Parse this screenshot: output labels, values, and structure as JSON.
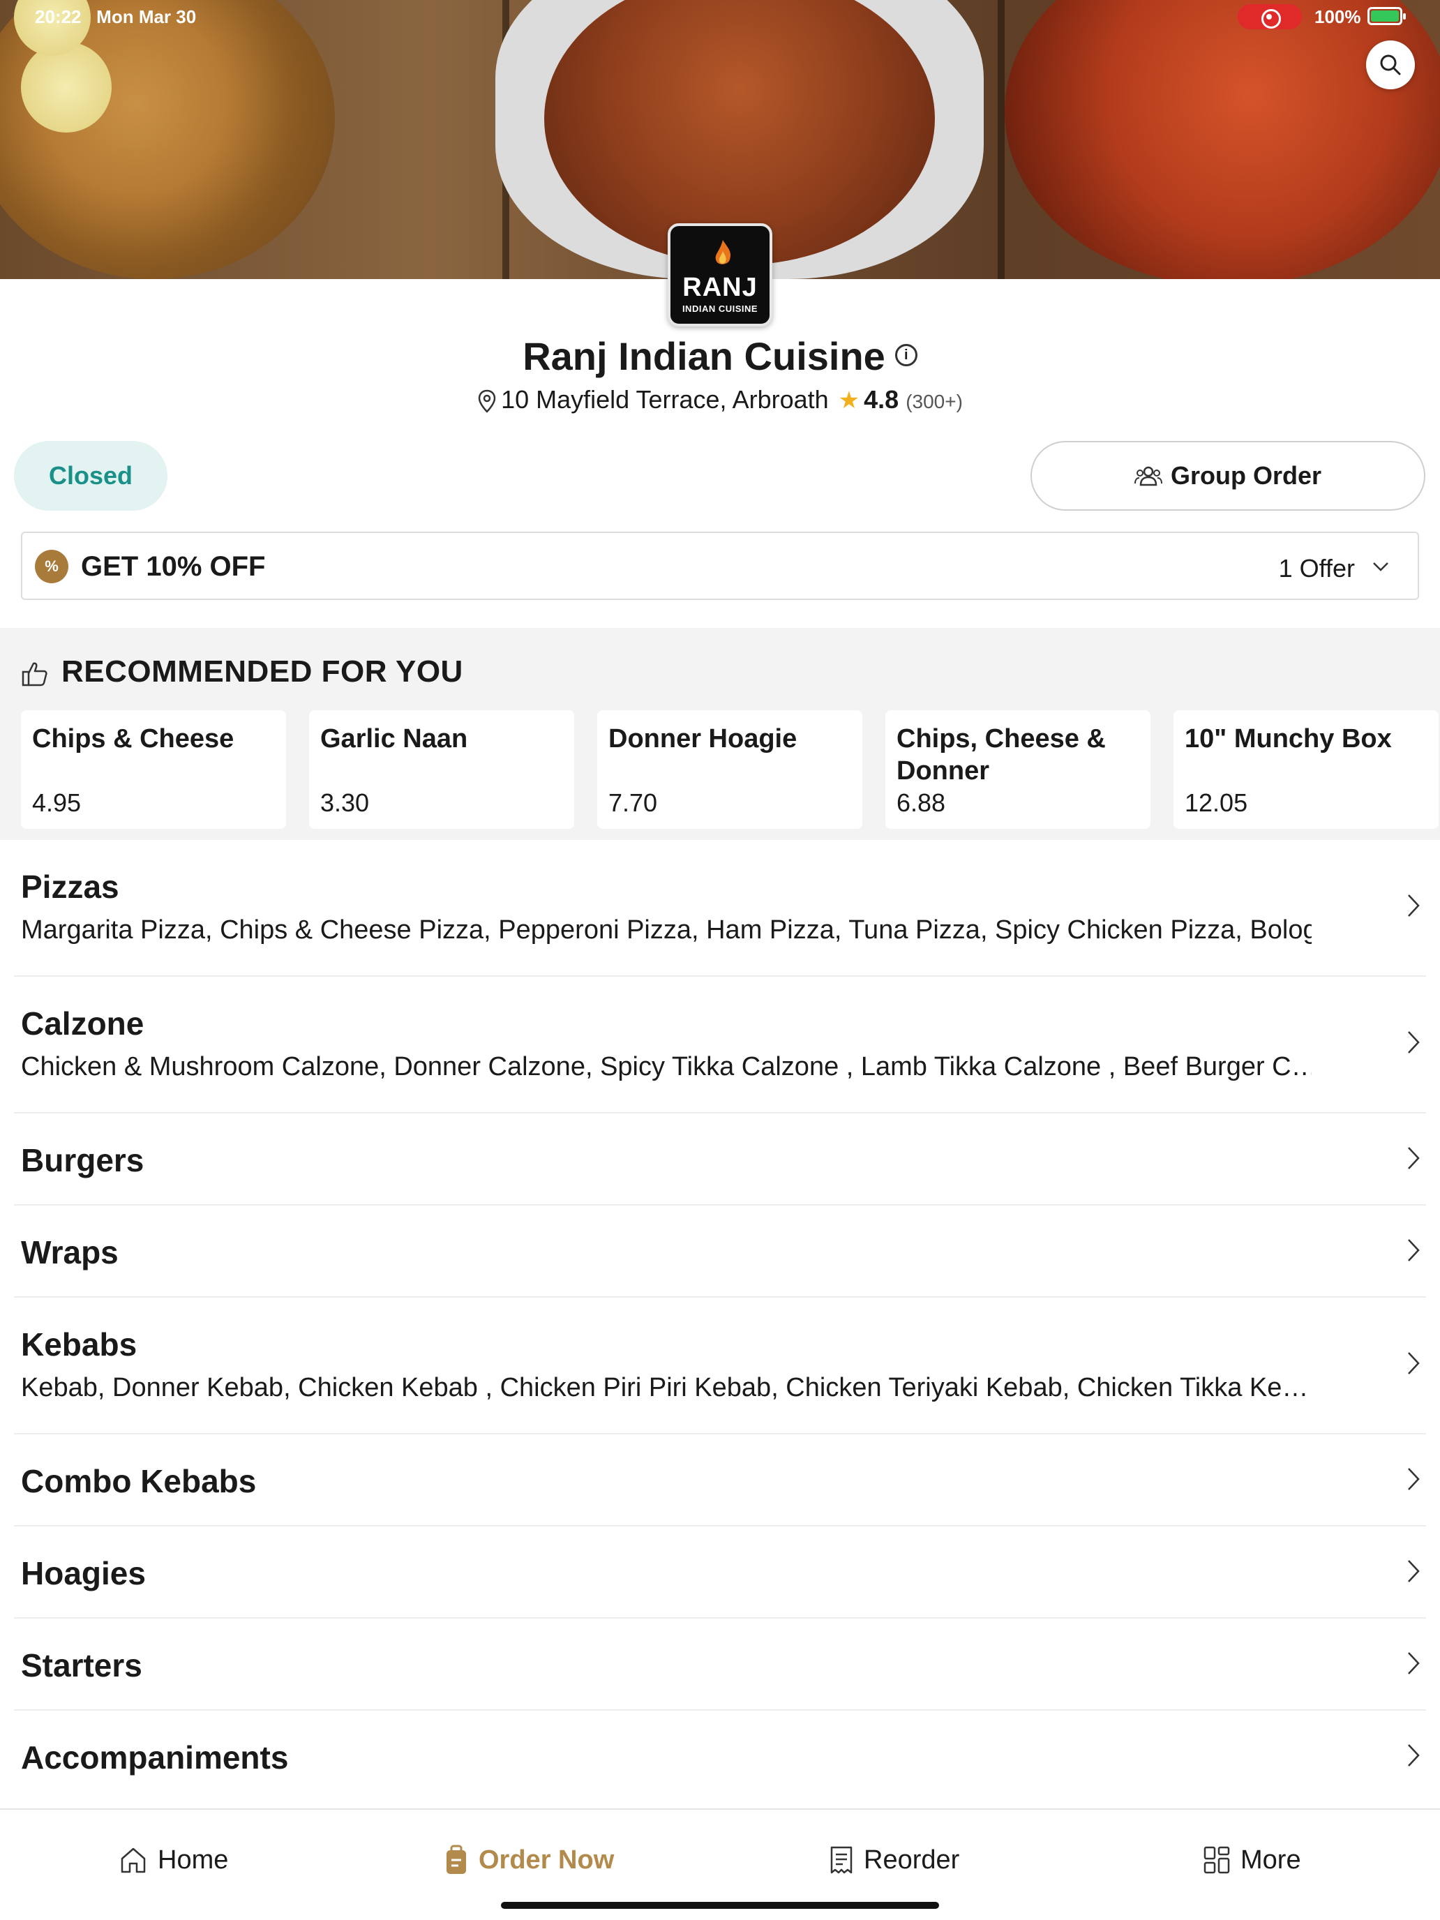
{
  "status": {
    "time": "20:22",
    "date": "Mon Mar 30",
    "battery": "100%"
  },
  "restaurant": {
    "name": "Ranj Indian Cuisine",
    "logo_main": "RANJ",
    "logo_sub": "INDIAN CUISINE",
    "address": "10 Mayfield Terrace, Arbroath",
    "rating": "4.8",
    "rating_count": "(300+)",
    "status": "Closed"
  },
  "group_order_label": "Group Order",
  "offer": {
    "title": "GET 10% OFF",
    "count": "1 Offer",
    "badge": "%"
  },
  "recommended": {
    "title": "RECOMMENDED FOR YOU",
    "items": [
      {
        "name": "Chips & Cheese",
        "price": "4.95"
      },
      {
        "name": "Garlic Naan",
        "price": "3.30"
      },
      {
        "name": "Donner Hoagie",
        "price": "7.70"
      },
      {
        "name": "Chips, Cheese & Donner",
        "price": "6.88"
      },
      {
        "name": "10\" Munchy Box",
        "price": "12.05"
      }
    ]
  },
  "categories": [
    {
      "title": "Pizzas",
      "desc": "Margarita Pizza, Chips & Cheese Pizza, Pepperoni Pizza, Ham Pizza, Tuna Pizza, Spicy Chicken Pizza, Bolog…"
    },
    {
      "title": "Calzone",
      "desc": "Chicken & Mushroom Calzone, Donner Calzone, Spicy Tikka Calzone , Lamb Tikka Calzone , Beef Burger C…"
    },
    {
      "title": "Burgers",
      "desc": ""
    },
    {
      "title": "Wraps",
      "desc": ""
    },
    {
      "title": "Kebabs",
      "desc": "Kebab, Donner Kebab, Chicken Kebab , Chicken Piri Piri Kebab, Chicken Teriyaki Kebab, Chicken Tikka Ke…"
    },
    {
      "title": "Combo Kebabs",
      "desc": ""
    },
    {
      "title": "Hoagies",
      "desc": ""
    },
    {
      "title": "Starters",
      "desc": ""
    },
    {
      "title": "Accompaniments",
      "desc": ""
    }
  ],
  "tabs": {
    "home": "Home",
    "order_now": "Order Now",
    "reorder": "Reorder",
    "more": "More"
  },
  "colors": {
    "accent": "#b28a4c",
    "closed_text": "#1b9088",
    "closed_bg": "#e2f3f2",
    "star": "#f2b01e"
  },
  "icons": [
    "search-icon",
    "info-icon",
    "location-pin-icon",
    "star-icon",
    "group-icon",
    "discount-badge-icon",
    "chevron-down-icon",
    "thumbs-up-icon",
    "chevron-right-icon",
    "home-icon",
    "order-bag-icon",
    "receipt-icon",
    "grid-icon"
  ]
}
